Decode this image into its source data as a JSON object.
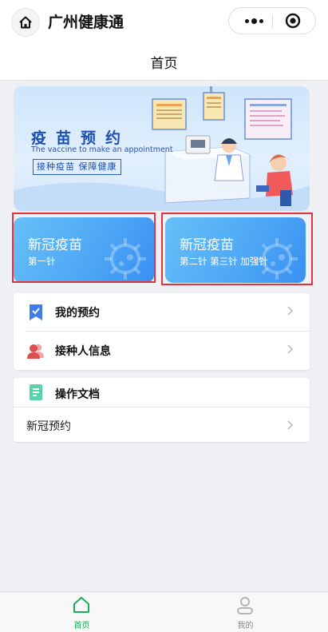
{
  "app": {
    "title": "广州健康通"
  },
  "nav": {
    "page_title": "首页"
  },
  "banner": {
    "title": "疫苗预约",
    "subtitle": "The vaccine to make an appointment",
    "tagline": "接种疫苗 保障健康"
  },
  "cards": [
    {
      "name": "新冠疫苗",
      "dose": "第一针"
    },
    {
      "name": "新冠疫苗",
      "dose": "第二针 第三针 加强针"
    }
  ],
  "menu": {
    "my_appointment": "我的预约",
    "vaccinee_info": "接种人信息"
  },
  "docs": {
    "title": "操作文档",
    "item": "新冠预约"
  },
  "tabs": [
    {
      "label": "首页",
      "active": true
    },
    {
      "label": "我的",
      "active": false
    }
  ],
  "colors": {
    "accent": "#1aad5a",
    "card_blue": "#4ca6f5",
    "highlight": "#e33340"
  },
  "icons": [
    "home-icon",
    "more-icon",
    "close-target-icon",
    "checkmark-icon",
    "user-icon",
    "document-icon",
    "chevron-right-icon",
    "home-tab-icon",
    "profile-tab-icon"
  ]
}
